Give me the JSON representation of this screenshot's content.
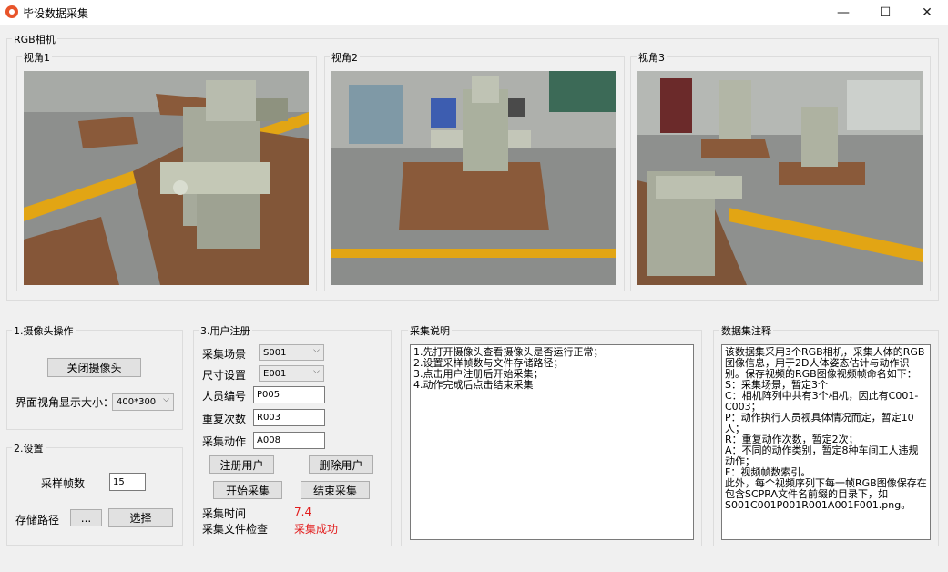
{
  "window": {
    "title": "毕设数据采集",
    "minimize": "—",
    "maximize": "☐",
    "close": "✕"
  },
  "rgb_camera": {
    "title": "RGB相机",
    "views": [
      {
        "label": "视角1"
      },
      {
        "label": "视角2"
      },
      {
        "label": "视角3"
      }
    ]
  },
  "camera_ops": {
    "title": "1.摄像头操作",
    "close_camera": "关闭摄像头",
    "view_size_label": "界面视角显示大小：",
    "view_size_value": "400*300"
  },
  "settings": {
    "title": "2.设置",
    "frame_rate_label": "采样帧数",
    "frame_rate_value": "15",
    "storage_label": "存储路径",
    "browse_button": "...",
    "select_button": "选择"
  },
  "user_register": {
    "title": "3.用户注册",
    "scene_label": "采集场景",
    "scene_value": "S001",
    "size_label": "尺寸设置",
    "size_value": "E001",
    "person_label": "人员编号",
    "person_value": "P005",
    "repeat_label": "重复次数",
    "repeat_value": "R003",
    "action_label": "采集动作",
    "action_value": "A008",
    "register_button": "注册用户",
    "delete_button": "删除用户",
    "start_button": "开始采集",
    "stop_button": "结束采集",
    "time_label": "采集时间",
    "time_value": "7.4",
    "check_label": "采集文件检查",
    "check_value": "采集成功"
  },
  "instructions": {
    "title": "采集说明",
    "text": "1.先打开摄像头查看摄像头是否运行正常；\n2.设置采样帧数与文件存储路径；\n3.点击用户注册后开始采集；\n4.动作完成后点击结束采集"
  },
  "dataset_notes": {
    "title": "数据集注释",
    "text": "该数据集采用3个RGB相机，采集人体的RGB图像信息，用于2D人体姿态估计与动作识别。保存视频的RGB图像视频帧命名如下：\nS：采集场景，暂定3个\nC：相机阵列中共有3个相机，因此有C001-C003；\nP：动作执行人员视具体情况而定，暂定10人；\nR：重复动作次数，暂定2次；\nA：不同的动作类别，暂定8种车间工人违规动作；\nF：视频帧数索引。\n此外，每个视频序列下每一帧RGB图像保存在包含SCPRA文件名前缀的目录下，如S001C001P001R001A001F001.png。"
  },
  "colors": {
    "accent_red": "#e21b1b",
    "floor": "#8a8c8a",
    "stripe": "#e8a812",
    "machine": "#b9bcae",
    "platform": "#8a5a3a"
  }
}
